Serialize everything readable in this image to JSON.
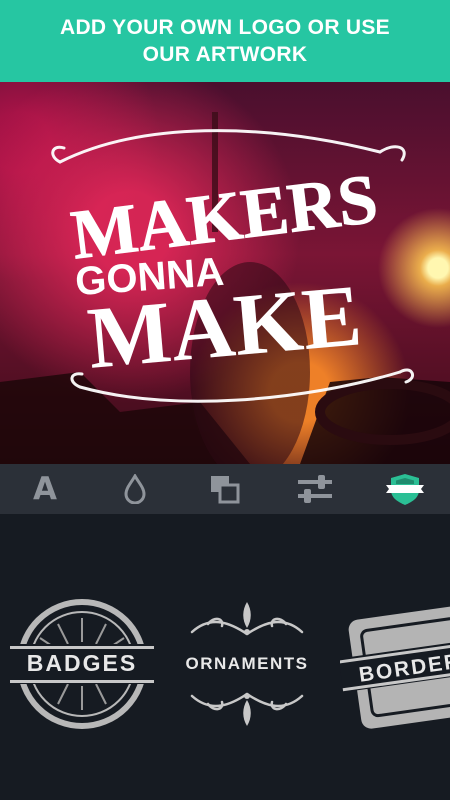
{
  "banner": {
    "text": "ADD YOUR OWN LOGO OR USE OUR ARTWORK"
  },
  "artwork": {
    "line1": "MAKERS",
    "line2": "GONNA",
    "line3": "MAKE"
  },
  "toolbar": {
    "items": [
      {
        "icon": "text-icon",
        "glyph": "A"
      },
      {
        "icon": "drop-icon"
      },
      {
        "icon": "layers-icon"
      },
      {
        "icon": "sliders-icon"
      },
      {
        "icon": "badge-icon",
        "active": true
      }
    ],
    "active_color": "#2bbf95",
    "inactive_color": "#8f949b"
  },
  "categories": [
    {
      "label": "BADGES"
    },
    {
      "label": "ORNAMENTS"
    },
    {
      "label": "BORDERS"
    }
  ],
  "colors": {
    "accent": "#26c6a2",
    "background": "#161b22",
    "toolbar": "#2b3038"
  }
}
